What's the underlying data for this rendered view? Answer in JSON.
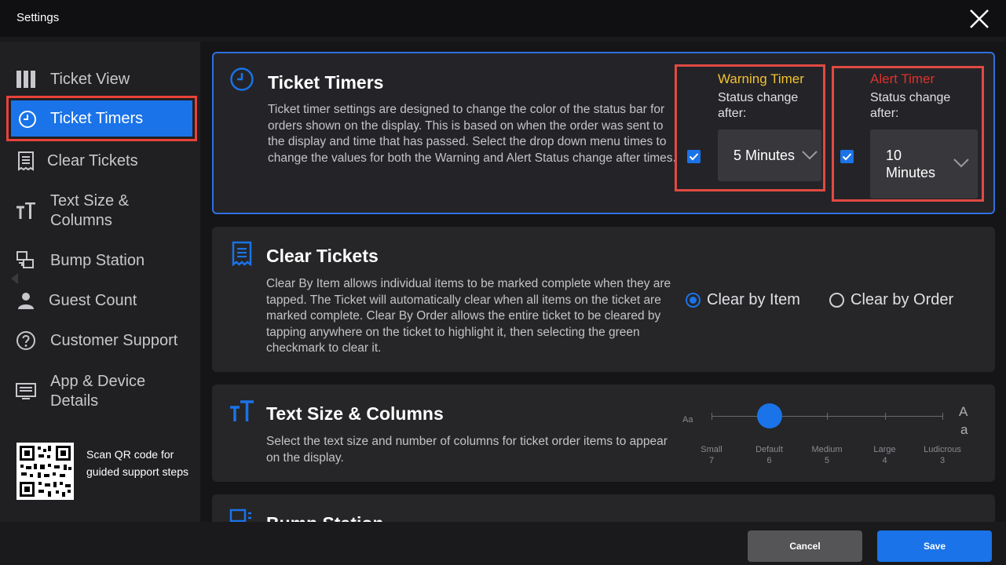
{
  "window": {
    "title": "Settings"
  },
  "sidebar": {
    "items": [
      {
        "label": "Ticket View",
        "icon": "columns-icon"
      },
      {
        "label": "Ticket Timers",
        "icon": "clock-icon",
        "active": true
      },
      {
        "label": "Clear Tickets",
        "icon": "receipt-icon"
      },
      {
        "label": "Text Size & Columns",
        "icon": "text-size-icon"
      },
      {
        "label": "Bump Station",
        "icon": "bump-icon"
      },
      {
        "label": "Guest Count",
        "icon": "person-icon"
      },
      {
        "label": "Customer Support",
        "icon": "help-icon"
      },
      {
        "label": "App & Device Details",
        "icon": "device-icon"
      }
    ],
    "qr_text": "Scan QR code for guided support steps"
  },
  "ticket_timers": {
    "title": "Ticket Timers",
    "description": "Ticket timer settings are designed to change the color of the status bar for orders shown on the display. This is based on when the order was sent to the display and time that has passed. Select the drop down menu times to change the values for both the Warning and Alert Status change after times.",
    "warning": {
      "title": "Warning Timer",
      "sub": "Status change after:",
      "value": "5 Minutes",
      "checked": true,
      "color": "#f2c230"
    },
    "alert": {
      "title": "Alert Timer",
      "sub": "Status change after:",
      "value": "10 Minutes",
      "checked": true,
      "color": "#e0302a"
    }
  },
  "clear_tickets": {
    "title": "Clear Tickets",
    "description": "Clear By Item allows individual items to be marked complete when they are tapped. The Ticket will automatically clear when all items on the ticket are marked complete. Clear By Order allows the entire ticket to be cleared by tapping anywhere on the ticket to highlight it, then selecting the green checkmark to clear it.",
    "options": [
      "Clear by Item",
      "Clear by Order"
    ],
    "selected": "Clear by Item"
  },
  "text_size": {
    "title": "Text Size & Columns",
    "description": "Select the text size and number of columns for ticket order items to appear on the display.",
    "small_glyph": "Aa",
    "large_glyph_top": "A",
    "large_glyph_bottom": "a",
    "levels": [
      {
        "name": "Small",
        "cols": "7"
      },
      {
        "name": "Default",
        "cols": "6"
      },
      {
        "name": "Medium",
        "cols": "5"
      },
      {
        "name": "Large",
        "cols": "4"
      },
      {
        "name": "Ludicrous",
        "cols": "3"
      }
    ],
    "selected": "Default"
  },
  "bump_station": {
    "title": "Bump Station"
  },
  "footer": {
    "cancel": "Cancel",
    "save": "Save"
  },
  "colors": {
    "accent": "#1a73e8",
    "highlight_border": "#e8423a"
  }
}
